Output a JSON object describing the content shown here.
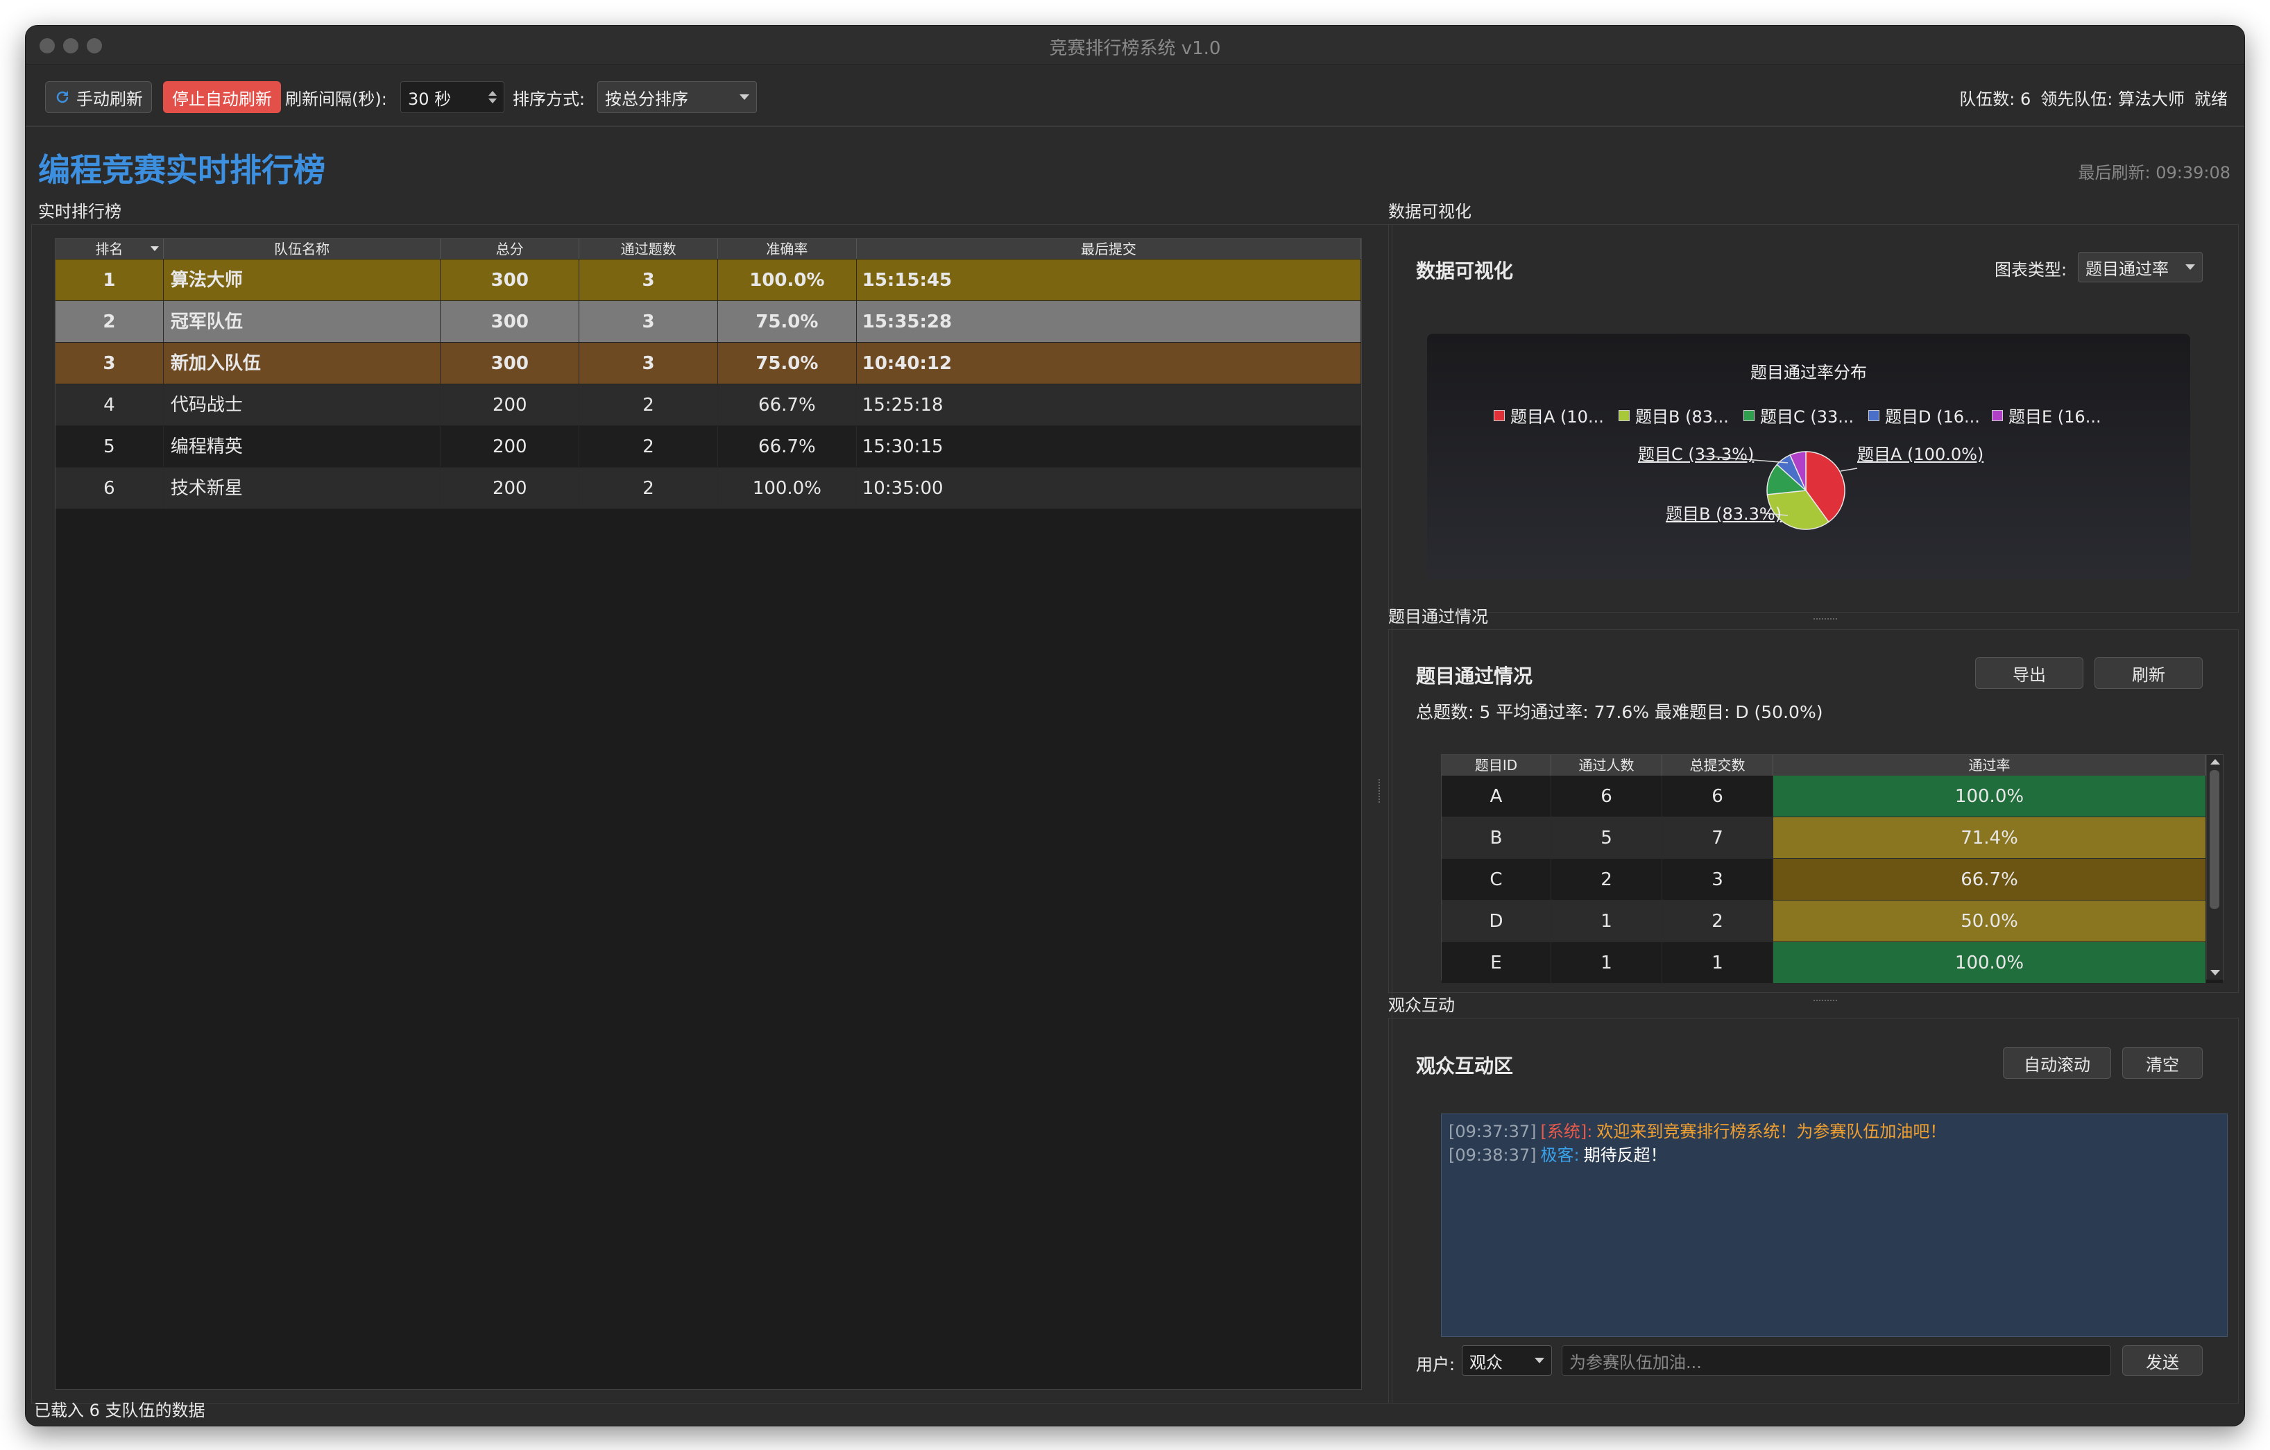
{
  "window": {
    "title": "竞赛排行榜系统 v1.0"
  },
  "toolbar": {
    "manual_refresh": "手动刷新",
    "stop_auto_refresh": "停止自动刷新",
    "interval_label": "刷新间隔(秒):",
    "interval_value": "30 秒",
    "sort_label": "排序方式:",
    "sort_value": "按总分排序",
    "team_count": "队伍数: 6",
    "leader": "领先队伍: 算法大师",
    "state": "就绪"
  },
  "main": {
    "heading": "编程竞赛实时排行榜",
    "last_refresh": "最后刷新: 09:39:08"
  },
  "ranking": {
    "section_title": "实时排行榜",
    "columns": [
      "排名",
      "队伍名称",
      "总分",
      "通过题数",
      "准确率",
      "最后提交"
    ],
    "rows": [
      {
        "rank": "1",
        "team": "算法大师",
        "score": "300",
        "solved": "3",
        "accuracy": "100.0%",
        "last": "15:15:45",
        "bg": "#7c6511"
      },
      {
        "rank": "2",
        "team": "冠军队伍",
        "score": "300",
        "solved": "3",
        "accuracy": "75.0%",
        "last": "15:35:28",
        "bg": "#7a7a7a"
      },
      {
        "rank": "3",
        "team": "新加入队伍",
        "score": "300",
        "solved": "3",
        "accuracy": "75.0%",
        "last": "10:40:12",
        "bg": "#6e4a23"
      },
      {
        "rank": "4",
        "team": "代码战士",
        "score": "200",
        "solved": "2",
        "accuracy": "66.7%",
        "last": "15:25:18",
        "bg": "#2c2c2c"
      },
      {
        "rank": "5",
        "team": "编程精英",
        "score": "200",
        "solved": "2",
        "accuracy": "66.7%",
        "last": "15:30:15",
        "bg": "#1e1e1e"
      },
      {
        "rank": "6",
        "team": "技术新星",
        "score": "200",
        "solved": "2",
        "accuracy": "100.0%",
        "last": "10:35:00",
        "bg": "#2c2c2c"
      }
    ]
  },
  "visual": {
    "section_title": "数据可视化",
    "panel_title": "数据可视化",
    "chart_type_label": "图表类型:",
    "chart_type_value": "题目通过率",
    "chart_title": "题目通过率分布",
    "legend": [
      {
        "label": "题目A (10...",
        "color": "#e0303a"
      },
      {
        "label": "题目B (83...",
        "color": "#a8c83a"
      },
      {
        "label": "题目C (33...",
        "color": "#2f9e4e"
      },
      {
        "label": "题目D (16...",
        "color": "#4a6fc8"
      },
      {
        "label": "题目E (16...",
        "color": "#b040c8"
      }
    ],
    "callouts": {
      "a": "题目A (100.0%)",
      "b": "题目B (83.3%)",
      "c": "题目C (33.3%)"
    }
  },
  "chart_data": {
    "type": "pie",
    "title": "题目通过率分布",
    "categories": [
      "题目A",
      "题目B",
      "题目C",
      "题目D",
      "题目E"
    ],
    "values": [
      100.0,
      83.3,
      33.3,
      16.7,
      16.7
    ],
    "colors": [
      "#e0303a",
      "#a8c83a",
      "#2f9e4e",
      "#4a6fc8",
      "#b040c8"
    ],
    "legend": "top"
  },
  "problems": {
    "section_title": "题目通过情况",
    "panel_title": "题目通过情况",
    "export_label": "导出",
    "refresh_label": "刷新",
    "summary": "总题数: 5  平均通过率: 77.6%  最难题目: D (50.0%)",
    "columns": [
      "题目ID",
      "通过人数",
      "总提交数",
      "通过率"
    ],
    "rows": [
      {
        "id": "A",
        "passed": "6",
        "submitted": "6",
        "rate": "100.0%",
        "bg": "#1f6e3c"
      },
      {
        "id": "B",
        "passed": "5",
        "submitted": "7",
        "rate": "71.4%",
        "bg": "#8a7520"
      },
      {
        "id": "C",
        "passed": "2",
        "submitted": "3",
        "rate": "66.7%",
        "bg": "#6c5513"
      },
      {
        "id": "D",
        "passed": "1",
        "submitted": "2",
        "rate": "50.0%",
        "bg": "#8a7520"
      },
      {
        "id": "E",
        "passed": "1",
        "submitted": "1",
        "rate": "100.0%",
        "bg": "#1f6e3c"
      }
    ]
  },
  "interaction": {
    "section_title": "观众互动",
    "panel_title": "观众互动区",
    "auto_scroll": "自动滚动",
    "clear": "清空",
    "messages": [
      {
        "time": "[09:37:37]",
        "user": "[系统]:",
        "text": "欢迎来到竞赛排行榜系统！为参赛队伍加油吧！",
        "user_color": "#e85a4a",
        "text_color": "#f0a030"
      },
      {
        "time": "[09:38:37]",
        "user": "极客:",
        "text": "期待反超！",
        "user_color": "#3aa0e8",
        "text_color": "#ffffff"
      }
    ],
    "user_label": "用户:",
    "user_value": "观众",
    "input_placeholder": "为参赛队伍加油...",
    "send": "发送"
  },
  "status_bar": {
    "text": "已载入 6 支队伍的数据"
  }
}
